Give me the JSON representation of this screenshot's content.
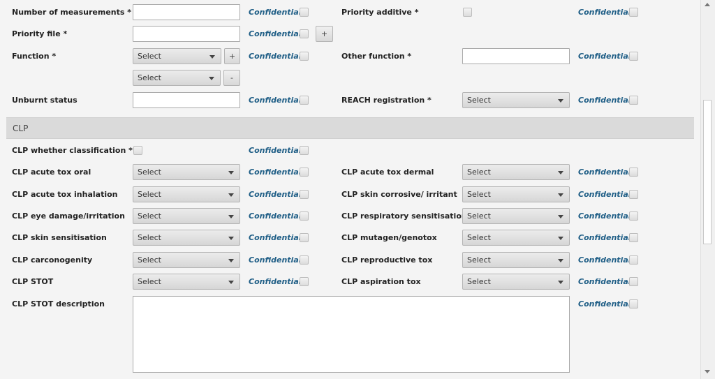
{
  "confidential_label": "Confidential",
  "select_placeholder": "Select",
  "fields": {
    "num_measurements": "Number of measurements *",
    "priority_additive": "Priority additive *",
    "priority_file": "Priority file *",
    "function": "Function *",
    "other_function": "Other function *",
    "unburnt_status": "Unburnt status",
    "reach_registration": "REACH registration *"
  },
  "buttons": {
    "add": "+",
    "remove": "-"
  },
  "section": {
    "title": "CLP"
  },
  "clp": {
    "whether_classification": "CLP whether classification *",
    "acute_tox_oral": "CLP acute tox oral",
    "acute_tox_dermal": "CLP acute tox dermal",
    "acute_tox_inhalation": "CLP acute tox inhalation",
    "skin_corrosive": "CLP skin corrosive/ irritant",
    "eye_damage": "CLP eye damage/irritation",
    "respiratory_sensitisation": "CLP respiratory sensitisation",
    "skin_sensitisation": "CLP skin sensitisation",
    "mutagen": "CLP mutagen/genotox",
    "carconogenity": "CLP carconogenity",
    "reproductive_tox": "CLP reproductive tox",
    "stot": "CLP STOT",
    "aspiration_tox": "CLP aspiration tox",
    "stot_description": "CLP STOT description"
  }
}
